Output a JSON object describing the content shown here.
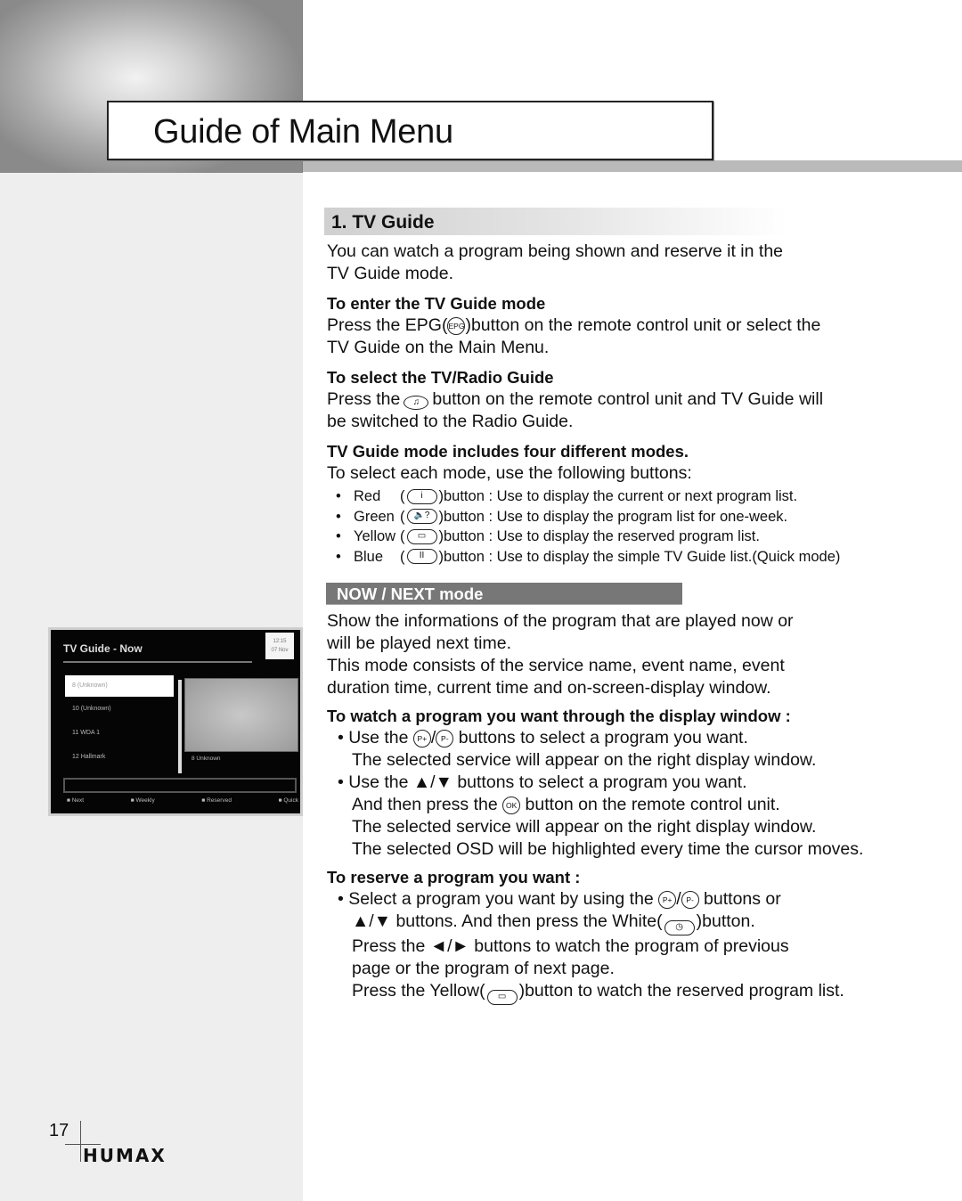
{
  "header": {
    "title": "Guide of Main Menu"
  },
  "section": {
    "title": "1. TV Guide",
    "intro_1": "You can watch a program being shown and reserve it in the",
    "intro_2": "TV Guide mode.",
    "enter": {
      "heading": "To enter the TV Guide mode",
      "line1_pre": "Press the EPG(",
      "epg_icon_label": "EPG",
      "line1_post": ")button on the remote control unit or select the",
      "line2": "TV Guide on the Main Menu."
    },
    "radio": {
      "heading": "To select the TV/Radio Guide",
      "line1_pre": "Press the",
      "icon_label": "♫",
      "line1_post": "button on the remote control unit and TV Guide will",
      "line2": "be switched to the Radio Guide."
    },
    "modes": {
      "heading": "TV Guide mode includes four different modes.",
      "intro": "To select each mode, use the following buttons:",
      "items": [
        {
          "color": "Red",
          "icon": "i",
          "text": ")button : Use to display the current or next program list."
        },
        {
          "color": "Green",
          "icon": "🔈?",
          "text": ")button : Use to display the program list for one-week."
        },
        {
          "color": "Yellow",
          "icon": "▭",
          "text": ")button : Use to display the reserved program list."
        },
        {
          "color": "Blue",
          "icon": "II",
          "text": ")button : Use to display the simple TV Guide list.(Quick mode)"
        }
      ]
    }
  },
  "now_next": {
    "bar_label": "NOW / NEXT mode",
    "desc_1": "Show the informations of the program that are played now or",
    "desc_2": "will be played next time.",
    "desc_3": "This mode consists of the service name, event name, event",
    "desc_4": "duration time, current time and on-screen-display window.",
    "watch": {
      "heading": "To watch a program you want through the display window :",
      "b1_pre": "• Use the",
      "p_plus": "P+",
      "p_minus": "P-",
      "b1_post": "buttons to select a program you want.",
      "b1_line2": "The selected service will appear on the right display window.",
      "b2_pre": "• Use the",
      "arrows_updown": "▲/▼",
      "b2_post": "buttons to select a program you want.",
      "b2_line2_pre": "And then press the",
      "ok_label": "OK",
      "b2_line2_post": "button on the remote control unit.",
      "b2_line3": "The selected service will appear on the right display window.",
      "b2_line4": "The selected OSD will be highlighted every time the cursor moves."
    },
    "reserve": {
      "heading": "To reserve a program you want :",
      "l1_pre": "• Select a program you want by using the",
      "l1_post": "buttons or",
      "l2_arrows": "▲/▼",
      "l2_text": "buttons. And then press the White(",
      "clock_icon": "◷",
      "l2_post": ")button.",
      "l3_pre": "Press the",
      "arrows_leftright": "◄/►",
      "l3_post": "buttons to watch the program of previous",
      "l4": "page or the program of next page.",
      "l5_pre": "Press the Yellow(",
      "yellow_icon": "▭",
      "l5_post": ")button to watch the reserved program list."
    }
  },
  "tv_screen": {
    "title": "TV Guide - Now",
    "clock_line1": "12:15",
    "clock_line2": "07 Nov",
    "channels": [
      "8  (Unknown)",
      "10  (Unknown)",
      "11  WDA 1",
      "12  Hallmark"
    ],
    "selected_channel_index": 0,
    "preview_label": "8   Unknown",
    "keys": [
      "Next",
      "Weekly",
      "Reserved",
      "Quick"
    ]
  },
  "footer": {
    "page_number": "17",
    "brand": "HUMAX"
  }
}
